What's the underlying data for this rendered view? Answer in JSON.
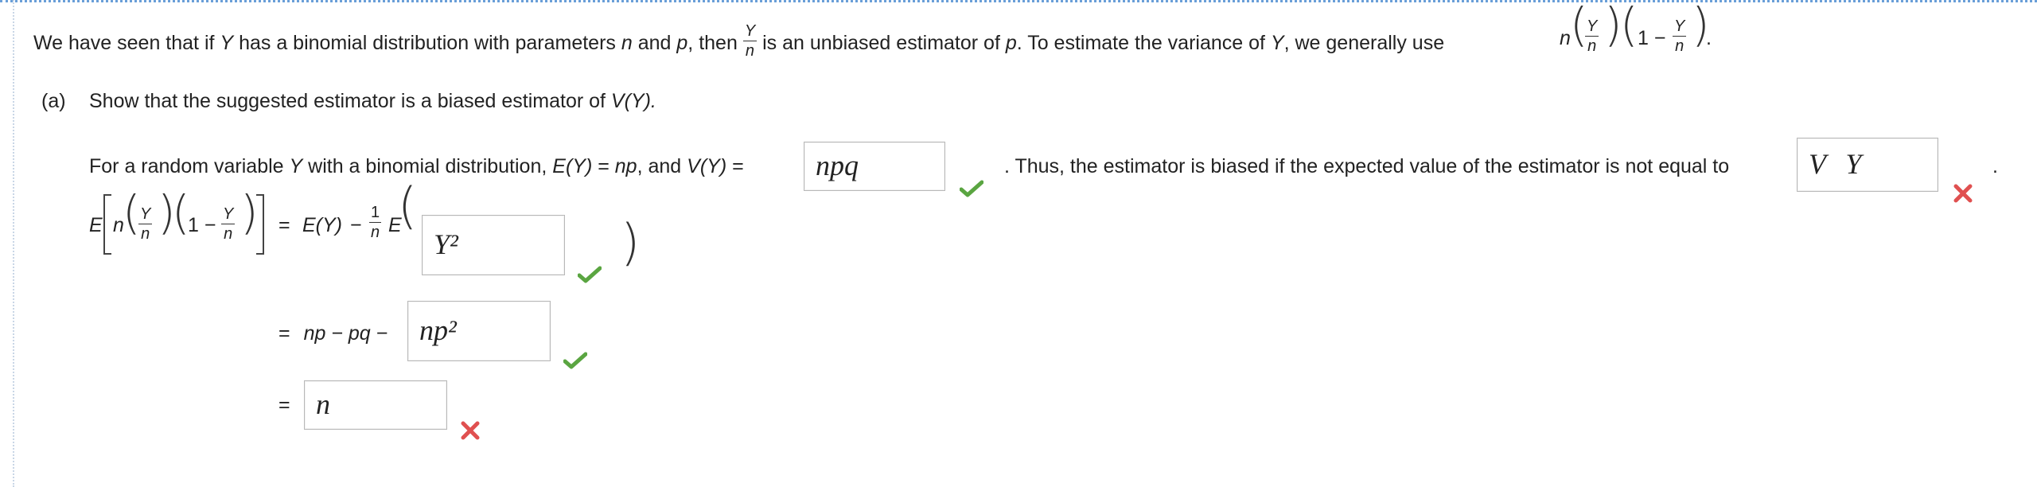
{
  "intro": {
    "part1": "We have seen that if",
    "Y": "Y",
    "part2": "has a binomial distribution with parameters",
    "n": "n",
    "and": "and",
    "p": "p",
    "part3": ", then",
    "frac_num": "Y",
    "frac_den": "n",
    "part4": "is an unbiased estimator of",
    "p2": "p",
    "part5": ". To estimate the variance of",
    "Y2": "Y",
    "part6": ", we generally use",
    "formula_n": "n",
    "formula_num1": "Y",
    "formula_den1": "n",
    "formula_one": "1 −",
    "formula_num2": "Y",
    "formula_den2": "n",
    "period": "."
  },
  "part_a": {
    "label": "(a)",
    "prompt_text": "Show that the suggested estimator is a biased estimator of",
    "prompt_v": "V(Y).",
    "line1_a": "For a random variable",
    "line1_Y": "Y",
    "line1_b": "with a binomial distribution,",
    "line1_EY": "E(Y)",
    "line1_c": "=",
    "line1_np": "np",
    "line1_d": ", and",
    "line1_VY": "V(Y)",
    "line1_e": "=",
    "line1_f": ". Thus, the estimator is biased if the expected value of the estimator is not equal to",
    "line1_g": ".",
    "eq_E": "E",
    "eq_n": "n",
    "eq_Y1": "Y",
    "eq_n1": "n",
    "eq_one": "1 −",
    "eq_Y2": "Y",
    "eq_n2": "n",
    "eq_equals": "=",
    "eq_EY": "E(Y)",
    "eq_minus": "−",
    "eq_frac_num": "1",
    "eq_frac_den": "n",
    "eq_E2": "E",
    "line3_eq": "=",
    "line3_text": "np − pq −",
    "line4_eq": "=",
    "answers": {
      "variance": "npq",
      "target": "V Y",
      "expectation": "Y²",
      "second": "np²",
      "final": "n"
    }
  },
  "colors": {
    "check": "#5aa541",
    "cross": "#e05050",
    "dotted_border": "#6a9fd8"
  }
}
